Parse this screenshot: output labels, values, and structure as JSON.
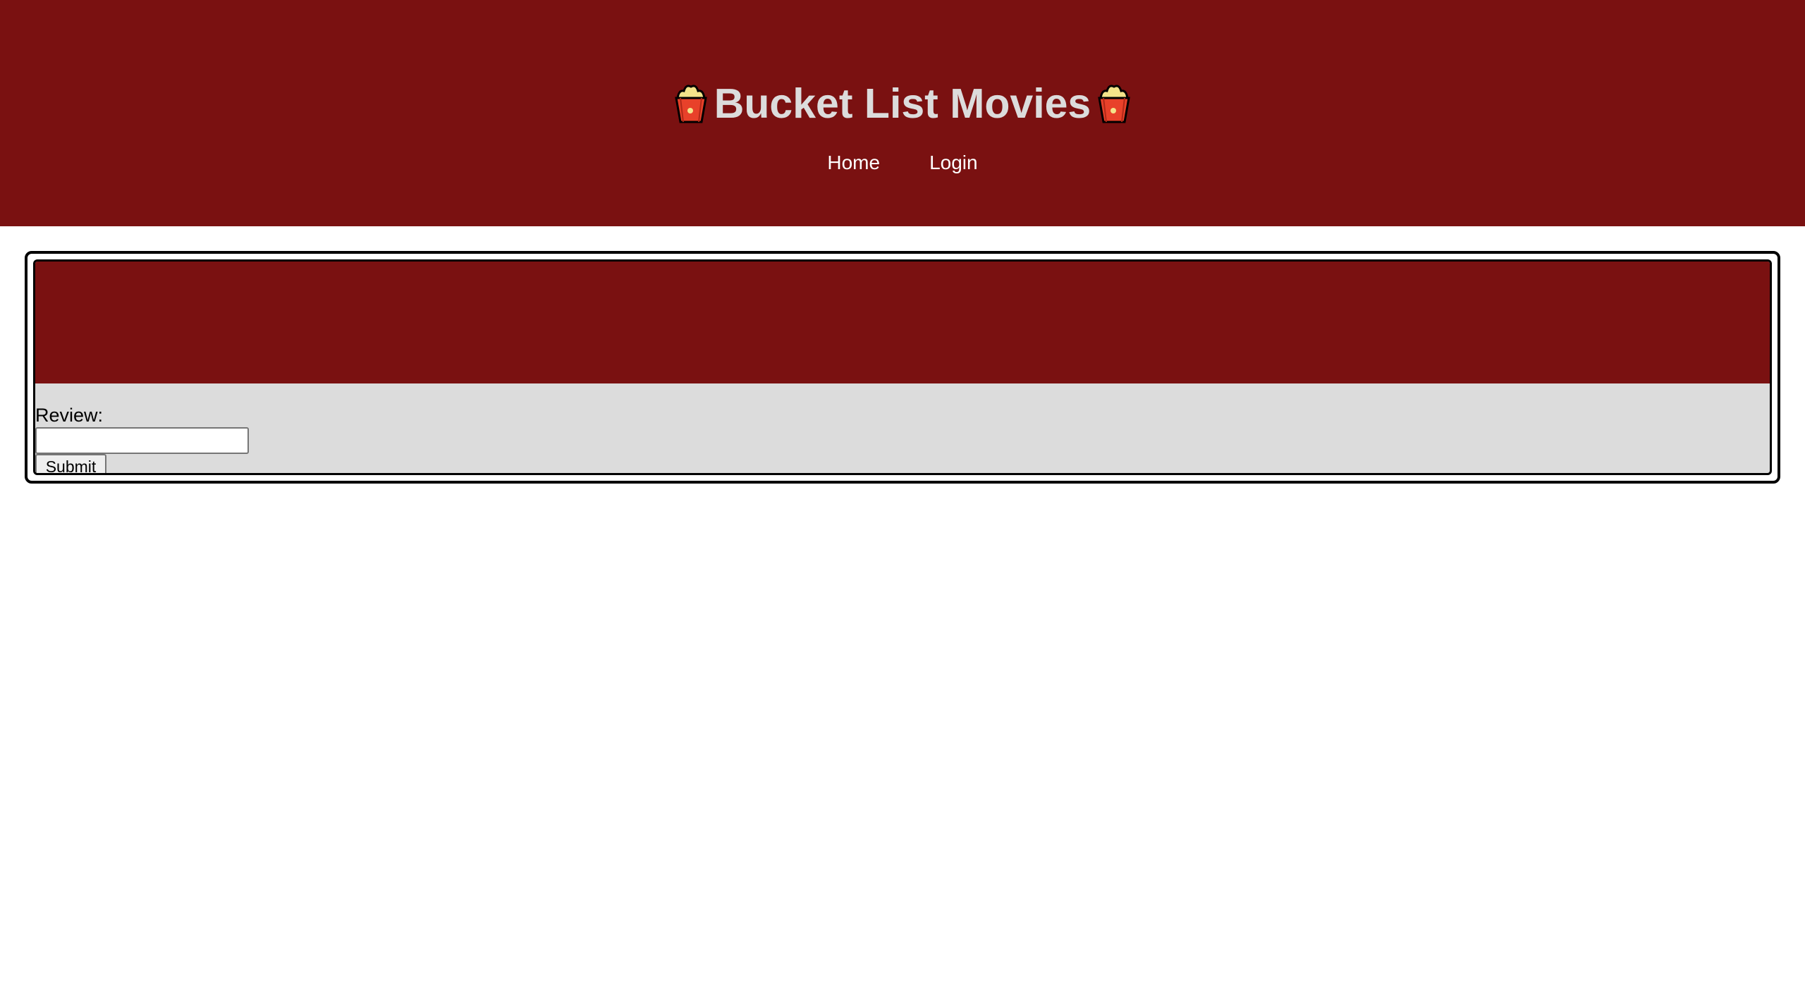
{
  "header": {
    "title": "Bucket List Movies",
    "icon_left": "popcorn-icon",
    "icon_right": "popcorn-icon",
    "background_color": "#7a1111",
    "title_color": "#dcdcdc"
  },
  "nav": {
    "items": [
      {
        "label": "Home"
      },
      {
        "label": "Login"
      }
    ]
  },
  "card": {
    "banner_color": "#7a1111",
    "body_color": "#dcdcdc",
    "review_label": "Review:",
    "review_value": "",
    "submit_label": "Submit"
  }
}
